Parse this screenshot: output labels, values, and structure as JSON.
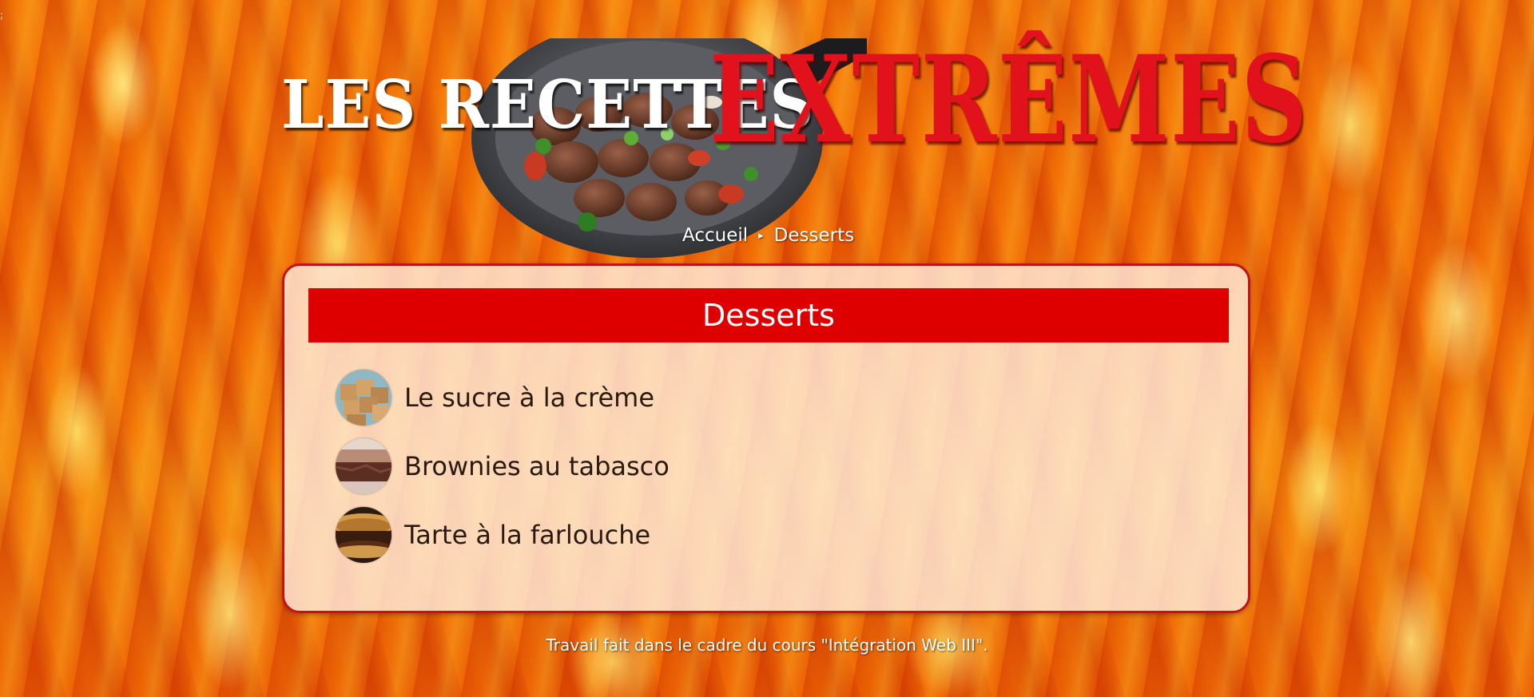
{
  "header": {
    "title_left": "LES RECETTES",
    "title_right": "EXTRÊMES"
  },
  "breadcrumb": {
    "home": "Accueil",
    "separator": "▸",
    "current": "Desserts"
  },
  "main": {
    "title": "Desserts",
    "recipes": [
      {
        "name": "Le sucre à la crème",
        "icon": "fudge-thumbnail"
      },
      {
        "name": "Brownies au tabasco",
        "icon": "brownie-thumbnail"
      },
      {
        "name": "Tarte à la farlouche",
        "icon": "pie-thumbnail"
      }
    ]
  },
  "footer": {
    "text": "Travail fait dans le cadre du cours \"Intégration Web III\"."
  },
  "colors": {
    "accent_red": "#de0000",
    "title_red": "#e1121c",
    "panel_bg": "#ffecdc"
  },
  "corner_mark": ";"
}
